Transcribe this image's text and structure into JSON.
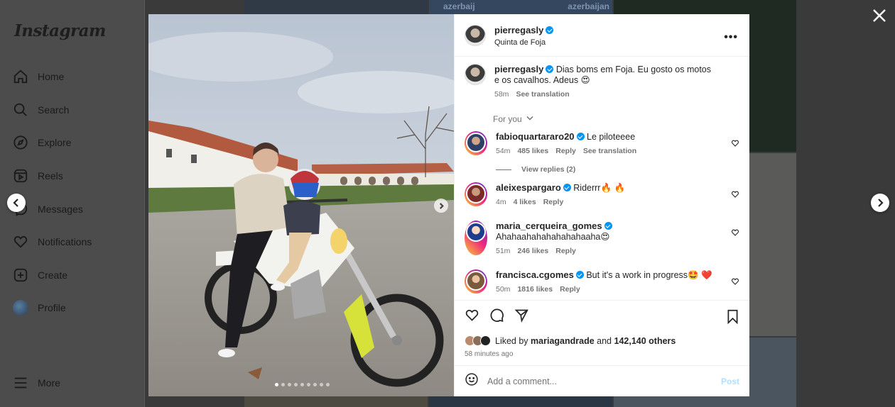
{
  "app": {
    "logo": "Instagram"
  },
  "sidebar": {
    "items": [
      {
        "label": "Home",
        "icon": "home-icon"
      },
      {
        "label": "Search",
        "icon": "search-icon"
      },
      {
        "label": "Explore",
        "icon": "compass-icon"
      },
      {
        "label": "Reels",
        "icon": "reels-icon"
      },
      {
        "label": "Messages",
        "icon": "messenger-icon"
      },
      {
        "label": "Notifications",
        "icon": "heart-icon"
      },
      {
        "label": "Create",
        "icon": "plus-square-icon"
      },
      {
        "label": "Profile",
        "icon": "avatar"
      }
    ],
    "more": "More"
  },
  "background_tiles_text": [
    "azerbaij",
    "azerbaijan"
  ],
  "post": {
    "author": "pierregasly",
    "location": "Quinta de Foja",
    "caption": {
      "user": "pierregasly",
      "text": "Dias boms em Foja. Eu gosto os motos e os cavalhos. Adeus 😍",
      "time": "58m",
      "translate": "See translation"
    },
    "sort_label": "For you",
    "comments": [
      {
        "user": "fabioquartararo20",
        "verified": true,
        "text": "Le piloteeee",
        "time": "54m",
        "likes": "485 likes",
        "reply": "Reply",
        "translate": "See translation",
        "replies": "View replies (2)"
      },
      {
        "user": "aleixespargaro",
        "verified": true,
        "text": "Riderrr🔥 🔥",
        "time": "4m",
        "likes": "4 likes",
        "reply": "Reply"
      },
      {
        "user": "maria_cerqueira_gomes",
        "verified": true,
        "text": "Ahahaahahahahahahaaha😍",
        "time": "51m",
        "likes": "246 likes",
        "reply": "Reply"
      },
      {
        "user": "francisca.cgomes",
        "verified": true,
        "text": "But it's a work in progress🤩 ❤️",
        "time": "50m",
        "likes": "1816 likes",
        "reply": "Reply"
      }
    ],
    "liked_by": {
      "prefix": "Liked by",
      "user": "mariagandrade",
      "and": "and",
      "others": "142,140 others"
    },
    "posted_ago": "58 minutes ago",
    "add_comment_placeholder": "Add a comment...",
    "post_button": "Post",
    "carousel": {
      "count": 9,
      "active": 0
    }
  },
  "colors": {
    "accent": "#0095f6",
    "post_disabled": "#b2dffc",
    "muted": "#737373"
  }
}
